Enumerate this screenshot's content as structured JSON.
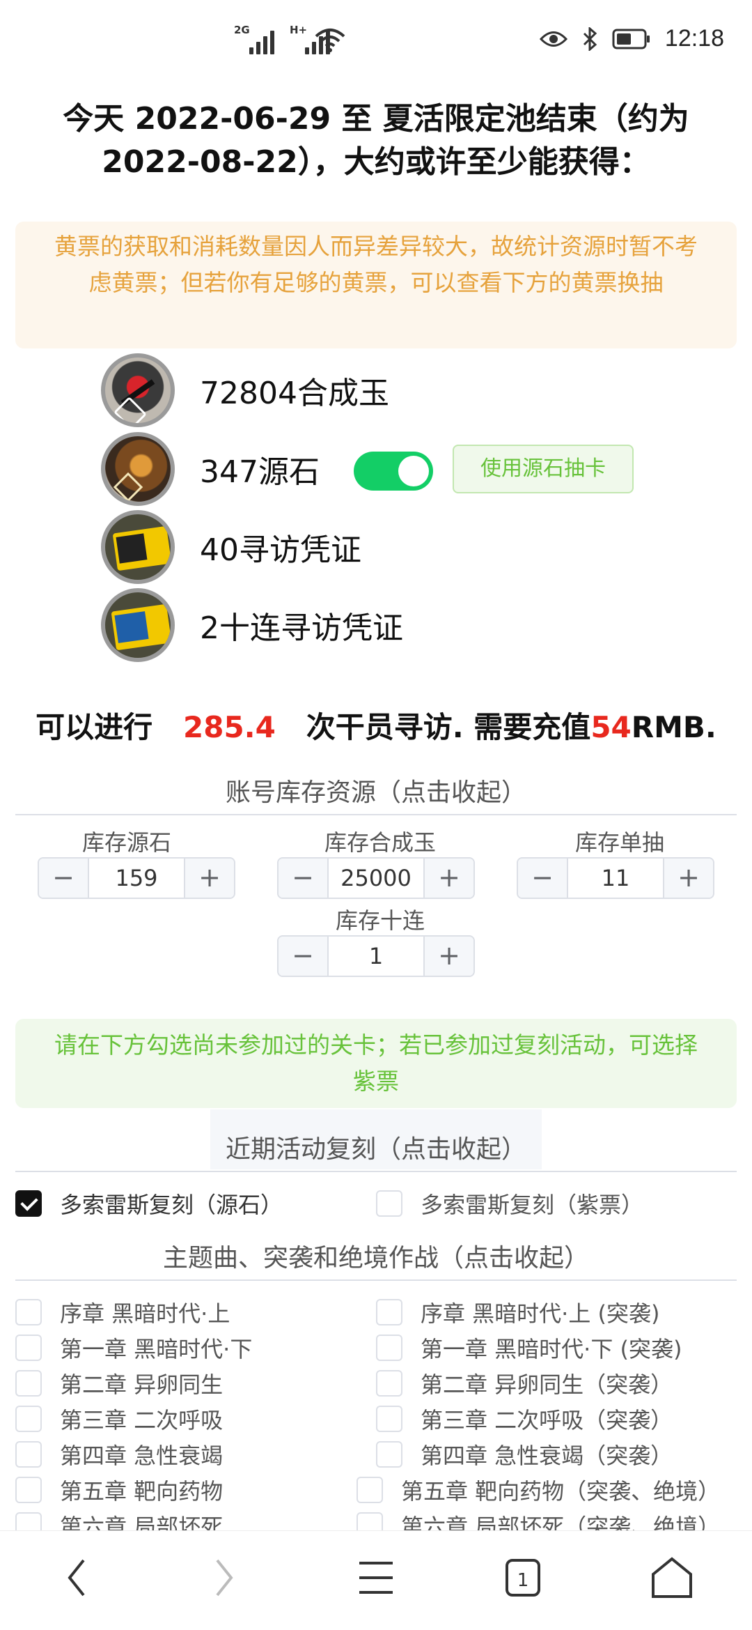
{
  "status": {
    "network1": "2G",
    "network2": "H+",
    "time": "12:18"
  },
  "header": {
    "line": "今天 2022-06-29 至 夏活限定池结束（约为 2022-08-22），大约或许至少能获得："
  },
  "notice_orange": "黄票的获取和消耗数量因人而异差异较大，故统计资源时暂不考虑黄票；但若你有足够的黄票，可以查看下方的黄票换抽",
  "resources": [
    {
      "icon": "orundum-icon",
      "text": "72804合成玉"
    },
    {
      "icon": "originite-icon",
      "text": "347源石"
    },
    {
      "icon": "headhunting-permit-icon",
      "text": "40寻访凭证"
    },
    {
      "icon": "ten-headhunting-permit-icon",
      "text": "2十连寻访凭证"
    }
  ],
  "originite_toggle": {
    "on": true,
    "button_label": "使用源石抽卡"
  },
  "result": {
    "prefix": "可以进行",
    "pulls": "285.4",
    "middle": "次干员寻访. 需要充值",
    "money": "54",
    "suffix": "RMB."
  },
  "stock": {
    "title": "账号库存资源（点击收起）",
    "items": [
      {
        "label": "库存源石",
        "value": "159"
      },
      {
        "label": "库存合成玉",
        "value": "25000"
      },
      {
        "label": "库存单抽",
        "value": "11"
      },
      {
        "label": "库存十连",
        "value": "1"
      }
    ],
    "minus": "−",
    "plus": "+"
  },
  "notice_green": "请在下方勾选尚未参加过的关卡；若已参加过复刻活动，可选择紫票",
  "rerun": {
    "title": "近期活动复刻（点击收起）",
    "items": [
      {
        "label": "多索雷斯复刻（源石）",
        "checked": true
      },
      {
        "label": "多索雷斯复刻（紫票）",
        "checked": false
      }
    ]
  },
  "main_story": {
    "title": "主题曲、突袭和绝境作战（点击收起）",
    "left": [
      "序章 黑暗时代·上",
      "第一章 黑暗时代·下",
      "第二章 异卵同生",
      "第三章 二次呼吸",
      "第四章 急性衰竭",
      "第五章 靶向药物",
      "第六章 局部坏死"
    ],
    "right": [
      "序章 黑暗时代·上 (突袭)",
      "第一章 黑暗时代·下 (突袭)",
      "第二章 异卵同生（突袭）",
      "第三章 二次呼吸（突袭）",
      "第四章 急性衰竭（突袭）",
      "第五章 靶向药物（突袭、绝境）",
      "第六章 局部坏死（突袭、绝境）"
    ]
  },
  "colors": {
    "accent_green": "#13ce66",
    "warn_orange": "#e6a23c",
    "success_green": "#67c23a",
    "highlight_red": "#e8281e"
  }
}
